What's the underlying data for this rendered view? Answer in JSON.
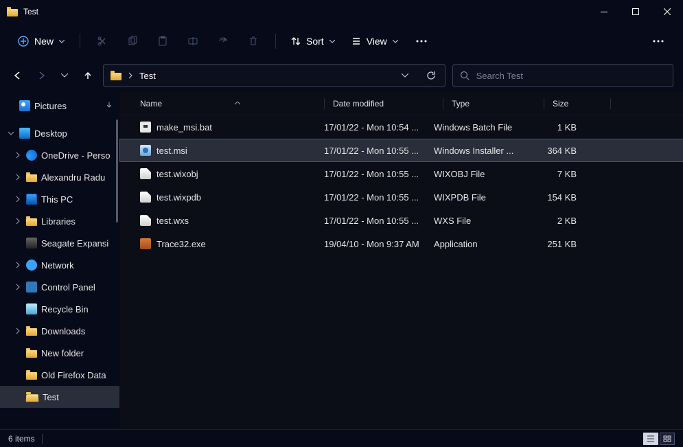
{
  "window": {
    "title": "Test"
  },
  "toolbar": {
    "new_label": "New",
    "sort_label": "Sort",
    "view_label": "View"
  },
  "address": {
    "crumb": "Test"
  },
  "search": {
    "placeholder": "Search Test"
  },
  "sidebar": {
    "pictures": "Pictures",
    "desktop": "Desktop",
    "items": [
      {
        "label": "OneDrive - Perso",
        "icon": "onedrive",
        "expandable": true
      },
      {
        "label": "Alexandru Radu",
        "icon": "folder",
        "expandable": true
      },
      {
        "label": "This PC",
        "icon": "thispc",
        "expandable": true
      },
      {
        "label": "Libraries",
        "icon": "folder",
        "expandable": true
      },
      {
        "label": "Seagate Expansi",
        "icon": "drive",
        "expandable": false
      },
      {
        "label": "Network",
        "icon": "net",
        "expandable": true
      },
      {
        "label": "Control Panel",
        "icon": "cpanel",
        "expandable": true
      },
      {
        "label": "Recycle Bin",
        "icon": "recycle",
        "expandable": false
      },
      {
        "label": "Downloads",
        "icon": "folder",
        "expandable": true
      },
      {
        "label": "New folder",
        "icon": "folder",
        "expandable": false
      },
      {
        "label": "Old Firefox Data",
        "icon": "folder",
        "expandable": false
      },
      {
        "label": "Test",
        "icon": "folder-open",
        "expandable": false,
        "selected": true
      }
    ]
  },
  "columns": {
    "name": "Name",
    "date": "Date modified",
    "type": "Type",
    "size": "Size"
  },
  "files": [
    {
      "name": "make_msi.bat",
      "date": "17/01/22 - Mon 10:54 ...",
      "type": "Windows Batch File",
      "size": "1 KB",
      "icon": "bat",
      "selected": false
    },
    {
      "name": "test.msi",
      "date": "17/01/22 - Mon 10:55 ...",
      "type": "Windows Installer ...",
      "size": "364 KB",
      "icon": "msi",
      "selected": true
    },
    {
      "name": "test.wixobj",
      "date": "17/01/22 - Mon 10:55 ...",
      "type": "WIXOBJ File",
      "size": "7 KB",
      "icon": "doc",
      "selected": false
    },
    {
      "name": "test.wixpdb",
      "date": "17/01/22 - Mon 10:55 ...",
      "type": "WIXPDB File",
      "size": "154 KB",
      "icon": "doc",
      "selected": false
    },
    {
      "name": "test.wxs",
      "date": "17/01/22 - Mon 10:55 ...",
      "type": "WXS File",
      "size": "2 KB",
      "icon": "doc",
      "selected": false
    },
    {
      "name": "Trace32.exe",
      "date": "19/04/10 - Mon 9:37 AM",
      "type": "Application",
      "size": "251 KB",
      "icon": "exe",
      "selected": false
    }
  ],
  "status": {
    "count": "6 items"
  }
}
